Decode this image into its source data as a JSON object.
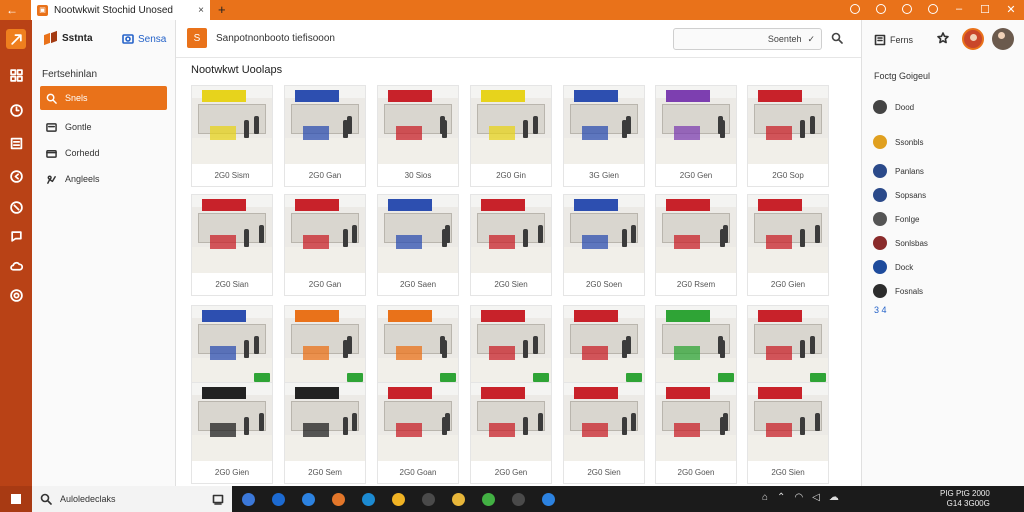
{
  "window": {
    "tab_title": "Nootwkwit Stochid Unosed",
    "tab_icon": "store-icon",
    "new_tab_label": "+",
    "back_label": "←",
    "close_tab_label": "×"
  },
  "titlebar_controls": {
    "minimize_label": "–",
    "maximize_label": "☐",
    "close_label": "✕"
  },
  "colors": {
    "accent": "#e9721a",
    "rail": "#b94216",
    "link": "#2563c9",
    "tag": "#2fa436"
  },
  "rail": {
    "items": [
      "home-icon",
      "grid-icon",
      "clock-icon",
      "list-icon",
      "compass-icon",
      "history-icon",
      "chat-icon",
      "cloud-icon",
      "settings-icon"
    ]
  },
  "sidebar": {
    "brand": "Sstnta",
    "search_label": "Sensa",
    "heading": "Fertsehinlan",
    "items": [
      {
        "label": "Snels",
        "icon": "search-icon",
        "active": true
      },
      {
        "label": "Gontle",
        "icon": "image-icon",
        "active": false
      },
      {
        "label": "Corhedd",
        "icon": "folder-icon",
        "active": false
      },
      {
        "label": "Angleels",
        "icon": "people-icon",
        "active": false
      }
    ]
  },
  "header": {
    "title": "Sanpotnonbooto tiefisooon",
    "logo_glyph": "S",
    "search_text": "Soenteh",
    "check_glyph": "✓"
  },
  "main": {
    "title": "Nootwkwt Uoolaps",
    "captions": [
      [
        "2G0 Sism",
        "2G0 Gan",
        "30 Sios",
        "2G0 Gin",
        "3G Gien",
        "2G0 Gen",
        "2G0 Sop"
      ],
      [
        "2G0 Sian",
        "2G0 Gan",
        "2G0 Saen",
        "2G0 Sien",
        "2G0 Soen",
        "2G0 Rsem",
        "2G0 Gien"
      ],
      [
        "",
        "",
        "",
        "",
        "",
        "",
        ""
      ],
      [
        "2G0 Gien",
        "2G0 Sem",
        "2G0 Goan",
        "2G0 Gen",
        "2G0 Sien",
        "2G0 Goen",
        "2G0 Sien"
      ]
    ],
    "sign_colors": [
      [
        "#e7d31c",
        "#2d4fb0",
        "#c8222a",
        "#e7d31c",
        "#2d4fb0",
        "#7d3fb0",
        "#c8222a"
      ],
      [
        "#c8222a",
        "#c8222a",
        "#2d4fb0",
        "#c8222a",
        "#2d4fb0",
        "#c8222a",
        "#c8222a"
      ],
      [
        "#2d4fb0",
        "#e9721a",
        "#e9721a",
        "#c8222a",
        "#c8222a",
        "#2fa436",
        "#c8222a"
      ],
      [
        "#222222",
        "#222222",
        "#c8222a",
        "#c8222a",
        "#c8222a",
        "#c8222a",
        "#c8222a"
      ]
    ],
    "tagged_row": 2
  },
  "right_panel": {
    "favorites_label": "Ferns",
    "heading": "Foctg Goigeul",
    "items": [
      {
        "label": "Dood",
        "icon": "dark-circle-icon",
        "color": "#444444"
      },
      {
        "label": "Ssonbls",
        "icon": "chrome-icon",
        "color": "#e0a020"
      },
      {
        "label": "Panlans",
        "icon": "app-icon",
        "color": "#2b4a8a"
      },
      {
        "label": "Sopsans",
        "icon": "app-icon",
        "color": "#2b4a8a"
      },
      {
        "label": "Fonlge",
        "icon": "app-icon",
        "color": "#555555"
      },
      {
        "label": "Sonlsbas",
        "icon": "app-icon",
        "color": "#8a2b2b"
      },
      {
        "label": "Dock",
        "icon": "app-icon",
        "color": "#1e4b9c"
      },
      {
        "label": "Fosnals",
        "icon": "app-icon",
        "color": "#2c2c2c"
      }
    ],
    "count": "3 4"
  },
  "taskbar": {
    "search_text": "Auloledeclaks",
    "apps": [
      "#3b78d9",
      "#1c6ad1",
      "#2c82e0",
      "#e2762a",
      "#1c8ad1",
      "#f0b324",
      "#4a4a4a",
      "#e7b63a",
      "#42b043",
      "#4a4a4a",
      "#2c82e0"
    ],
    "clock_line1": "PIG PtG 2000",
    "clock_line2": "G14 3G00G"
  }
}
